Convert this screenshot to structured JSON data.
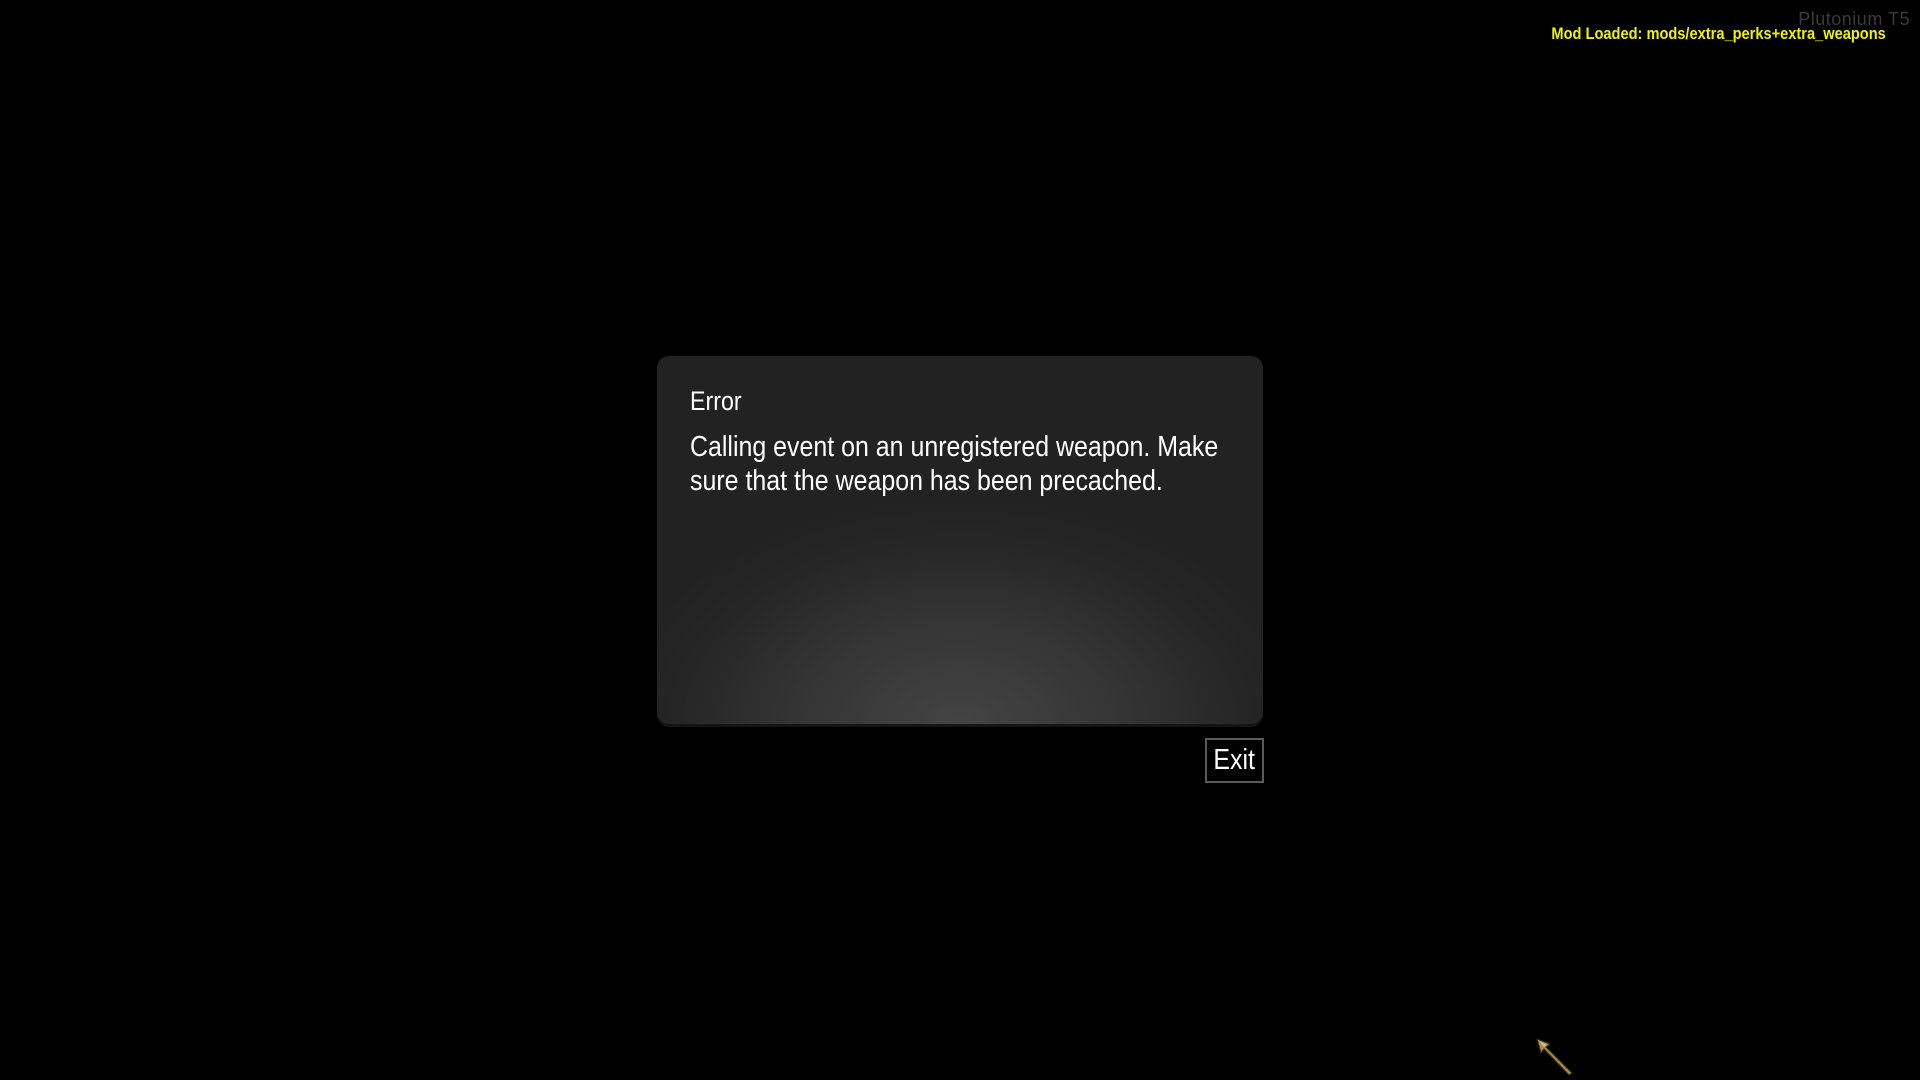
{
  "overlay": {
    "watermark": "Plutonium T5",
    "mod_loaded": "Mod Loaded: mods/extra_perks+extra_weapons"
  },
  "dialog": {
    "title": "Error",
    "message": "Calling event on an unregistered weapon. Make sure that the weapon has been precached.",
    "exit_label": "Exit"
  },
  "cursor": {
    "icon": "arrow-cursor-icon"
  },
  "colors": {
    "background": "#000000",
    "mod_text": "#f2f200",
    "dialog_text": "#ffffff",
    "watermark_text": "#3a3a3a"
  }
}
